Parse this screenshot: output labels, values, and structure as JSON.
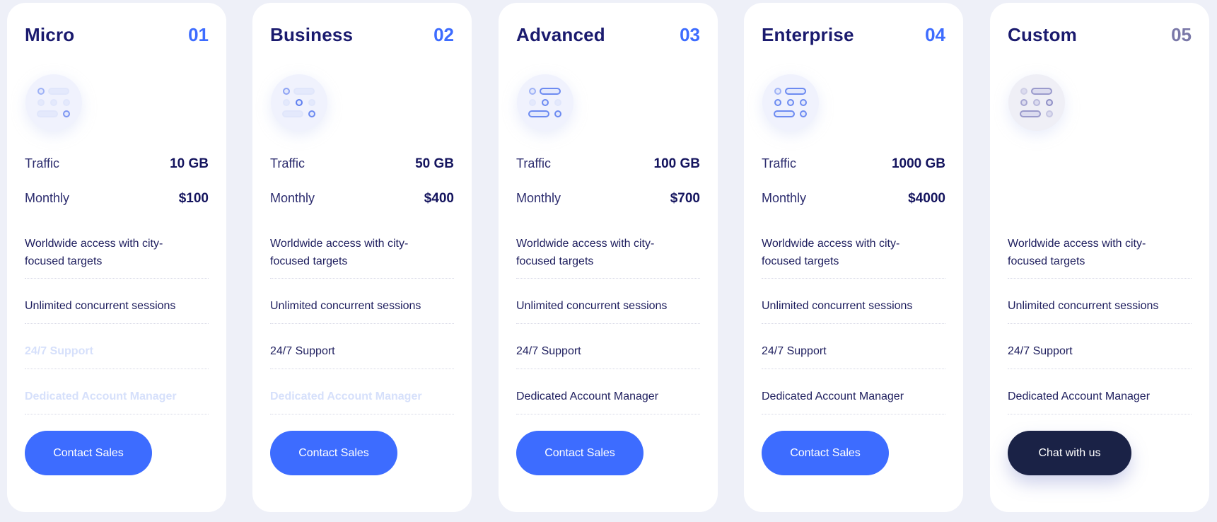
{
  "plans": [
    {
      "title": "Micro",
      "number": "01",
      "traffic_label": "Traffic",
      "traffic_value": "10 GB",
      "monthly_label": "Monthly",
      "monthly_value": "$100",
      "features": [
        {
          "text": "Worldwide access with city-focused targets",
          "enabled": true
        },
        {
          "text": "Unlimited concurrent sessions",
          "enabled": true
        },
        {
          "text": "24/7 Support",
          "enabled": false
        },
        {
          "text": "Dedicated Account Manager",
          "enabled": false
        }
      ],
      "cta": "Contact Sales",
      "icon": "plan-level-icon-1"
    },
    {
      "title": "Business",
      "number": "02",
      "traffic_label": "Traffic",
      "traffic_value": "50 GB",
      "monthly_label": "Monthly",
      "monthly_value": "$400",
      "features": [
        {
          "text": "Worldwide access with city-focused targets",
          "enabled": true
        },
        {
          "text": "Unlimited concurrent sessions",
          "enabled": true
        },
        {
          "text": "24/7 Support",
          "enabled": true
        },
        {
          "text": "Dedicated Account Manager",
          "enabled": false
        }
      ],
      "cta": "Contact Sales",
      "icon": "plan-level-icon-2"
    },
    {
      "title": "Advanced",
      "number": "03",
      "traffic_label": "Traffic",
      "traffic_value": "100 GB",
      "monthly_label": "Monthly",
      "monthly_value": "$700",
      "features": [
        {
          "text": "Worldwide access with city-focused targets",
          "enabled": true
        },
        {
          "text": "Unlimited concurrent sessions",
          "enabled": true
        },
        {
          "text": "24/7 Support",
          "enabled": true
        },
        {
          "text": "Dedicated Account Manager",
          "enabled": true
        }
      ],
      "cta": "Contact Sales",
      "icon": "plan-level-icon-3"
    },
    {
      "title": "Enterprise",
      "number": "04",
      "traffic_label": "Traffic",
      "traffic_value": "1000 GB",
      "monthly_label": "Monthly",
      "monthly_value": "$4000",
      "features": [
        {
          "text": "Worldwide access with city-focused targets",
          "enabled": true
        },
        {
          "text": "Unlimited concurrent sessions",
          "enabled": true
        },
        {
          "text": "24/7 Support",
          "enabled": true
        },
        {
          "text": "Dedicated Account Manager",
          "enabled": true
        }
      ],
      "cta": "Contact Sales",
      "icon": "plan-level-icon-4"
    },
    {
      "title": "Custom",
      "number": "05",
      "features": [
        {
          "text": "Worldwide access with city-focused targets",
          "enabled": true
        },
        {
          "text": "Unlimited concurrent sessions",
          "enabled": true
        },
        {
          "text": "24/7 Support",
          "enabled": true
        },
        {
          "text": "Dedicated Account Manager",
          "enabled": true
        }
      ],
      "cta": "Chat with us",
      "icon": "plan-level-icon-custom"
    }
  ],
  "colors": {
    "accent": "#3d6cff",
    "title": "#1a1a6e",
    "dark_button": "#1a2246",
    "disabled_text": "#d6e0fb",
    "muted_number": "#7a78a8"
  }
}
